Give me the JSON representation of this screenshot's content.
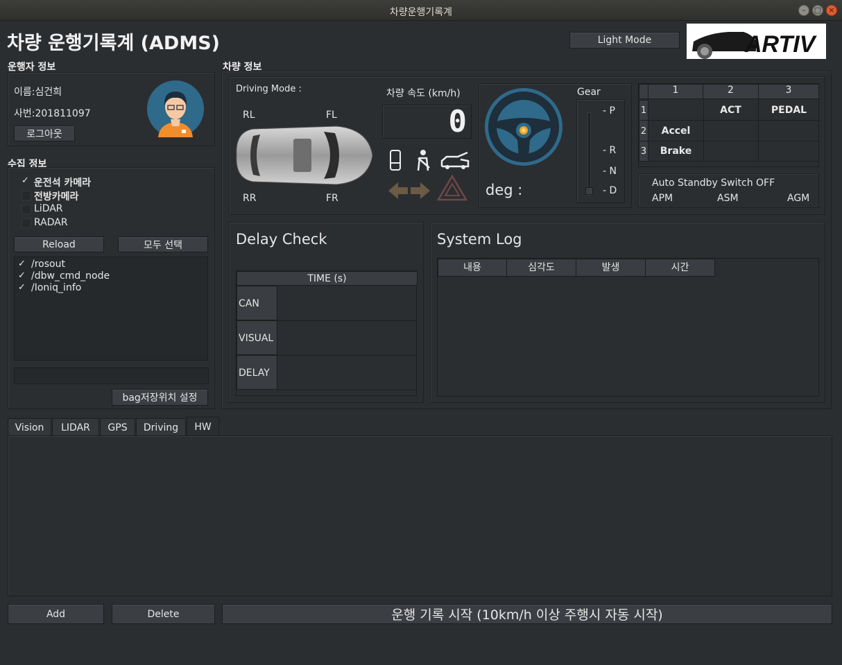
{
  "window": {
    "title": "차량운행기록계"
  },
  "header": {
    "title": "차량 운행기록계 (ADMS)",
    "light_mode_label": "Light Mode",
    "logo_text": "ARTIV"
  },
  "driver": {
    "section_title": "운행자 정보",
    "name": "이름:심건희",
    "id": "사번:201811097",
    "logout_label": "로그아웃"
  },
  "collect": {
    "section_title": "수집 정보",
    "sources": [
      {
        "label": "운전석 카메라",
        "checked": true
      },
      {
        "label": "전방카메라",
        "checked": false
      },
      {
        "label": "LiDAR",
        "checked": false
      },
      {
        "label": "RADAR",
        "checked": false
      }
    ],
    "reload_label": "Reload",
    "select_all_label": "모두 선택",
    "topics": [
      {
        "label": "/rosout",
        "checked": true
      },
      {
        "label": "/dbw_cmd_node",
        "checked": true
      },
      {
        "label": "/Ioniq_info",
        "checked": true
      }
    ],
    "path_value": "",
    "bag_location_label": "bag저장위치 설정"
  },
  "vehicle": {
    "section_title": "차량 정보",
    "driving_mode_label": "Driving Mode :",
    "wheels": {
      "rl": "RL",
      "fl": "FL",
      "rr": "RR",
      "fr": "FR"
    },
    "speed_label": "차량 속도 (km/h)",
    "speed_value": "0",
    "deg_label": "deg :",
    "gear_title": "Gear",
    "gears": [
      "- P",
      "- R",
      "- N",
      "- D"
    ],
    "status_colors": {
      "steering": "#3c6a8a",
      "steering_hub": "#f5a623",
      "inactive": "#6b5a44"
    }
  },
  "actuator_table": {
    "col_headers": [
      "1",
      "2",
      "3"
    ],
    "row_headers": [
      "1",
      "2",
      "3"
    ],
    "rows": [
      [
        "",
        "ACT",
        "PEDAL"
      ],
      [
        "Accel",
        "",
        ""
      ],
      [
        "Brake",
        "",
        ""
      ]
    ]
  },
  "standby": {
    "label": "Auto Standby Switch",
    "value": "OFF",
    "apm": "APM",
    "asm": "ASM",
    "agm": "AGM"
  },
  "delay_check": {
    "title": "Delay Check",
    "column": "TIME (s)",
    "rows": [
      "CAN",
      "VISUAL",
      "DELAY"
    ]
  },
  "system_log": {
    "title": "System Log",
    "columns": [
      "내용",
      "심각도",
      "발생",
      "시간"
    ]
  },
  "tabs": [
    {
      "label": "Vision",
      "active": false
    },
    {
      "label": "LIDAR",
      "active": false
    },
    {
      "label": "GPS",
      "active": false
    },
    {
      "label": "Driving",
      "active": false
    },
    {
      "label": "HW",
      "active": true
    }
  ],
  "footer": {
    "add_label": "Add",
    "delete_label": "Delete",
    "start_label": "운행 기록 시작 (10km/h 이상 주행시 자동 시작)"
  }
}
